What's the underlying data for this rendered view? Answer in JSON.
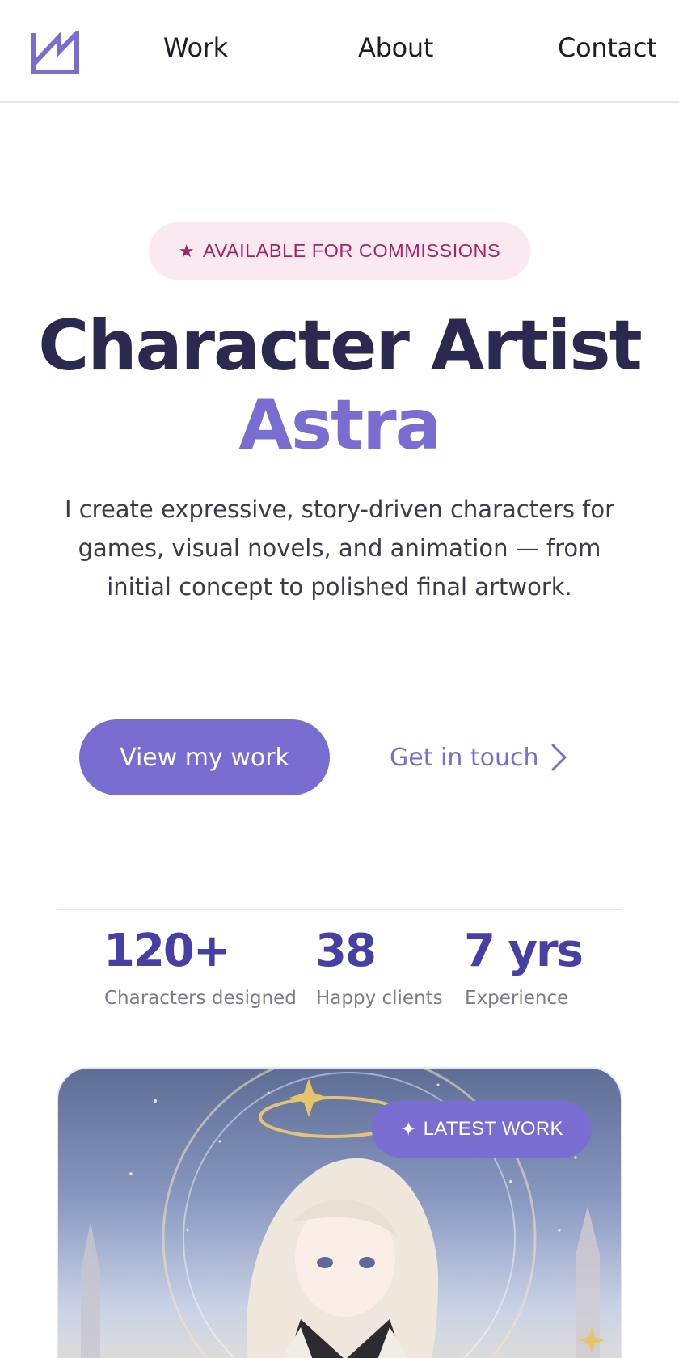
{
  "nav": {
    "logo_icon": "monogram-logo-icon",
    "links": [
      {
        "label": "Work"
      },
      {
        "label": "About"
      },
      {
        "label": "Contact"
      }
    ]
  },
  "hero": {
    "badge_icon": "star-icon",
    "badge_star": "★",
    "badge_text": "AVAILABLE FOR COMMISSIONS",
    "title": "Character Artist",
    "title_accent": "Astra",
    "description": "I create expressive, story-driven characters for games, visual novels, and animation — from initial concept to polished final artwork.",
    "primary_button": "View my work",
    "secondary_link": "Get in touch",
    "secondary_icon": "chevron-right-icon"
  },
  "stats": [
    {
      "value": "120+",
      "label": "Characters designed"
    },
    {
      "value": "38",
      "label": "Happy clients"
    },
    {
      "value": "7 yrs",
      "label": "Experience"
    }
  ],
  "featured": {
    "badge_icon": "sparkle-icon",
    "badge_spark": "✦",
    "badge_text": "LATEST WORK",
    "image_description": "anime-style illustration of a silver-haired girl with a golden halo under a starry sky"
  },
  "colors": {
    "accent": "#7a6dd2",
    "accent_dark": "#463fa6",
    "heading": "#2b2950",
    "badge_bg": "#fbe9f2",
    "badge_text": "#a3245f",
    "muted_text": "#7d7a8e"
  }
}
